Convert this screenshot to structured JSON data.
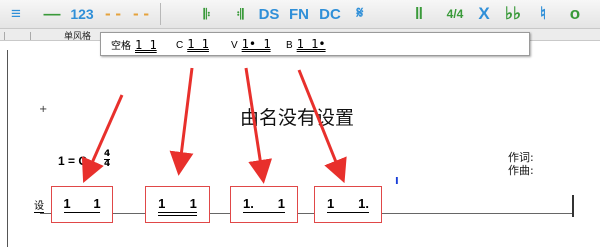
{
  "toolbar": {
    "buttons": [
      {
        "label": "≡"
      },
      {
        "label": "—"
      },
      {
        "label": "123"
      },
      {
        "label": "- -"
      },
      {
        "label": "- -"
      },
      {
        "label": "𝄆"
      },
      {
        "label": "𝄇"
      },
      {
        "label": "DS"
      },
      {
        "label": "FN"
      },
      {
        "label": "DC"
      },
      {
        "label": "𝄋"
      },
      {
        "label": "‖"
      },
      {
        "label": "4/4"
      },
      {
        "label": "X"
      },
      {
        "label": "♭♭"
      },
      {
        "label": "♮"
      },
      {
        "label": "o"
      }
    ]
  },
  "tabstrip": {
    "tab_label": "单风格"
  },
  "popup": {
    "options": [
      {
        "label": "空格",
        "example": "1 1"
      },
      {
        "label": "C",
        "example": "1 1"
      },
      {
        "label": "V",
        "example": "1• 1"
      },
      {
        "label": "B",
        "example": "1 1•"
      }
    ]
  },
  "score": {
    "title": "由名没有设置",
    "key": "1 = C",
    "time_top": "4",
    "time_bottom": "4",
    "lyricist": "作词:",
    "composer": "作曲:",
    "staff_label": "设",
    "boxes": [
      {
        "left": "1",
        "right": "1"
      },
      {
        "left": "1",
        "right": "1"
      },
      {
        "left": "1.",
        "right": "1"
      },
      {
        "left": "1",
        "right": "1."
      }
    ]
  },
  "colors": {
    "arrow": "#e8302c",
    "box_border": "#e04848",
    "toolbar_blue": "#2f8fd8"
  }
}
